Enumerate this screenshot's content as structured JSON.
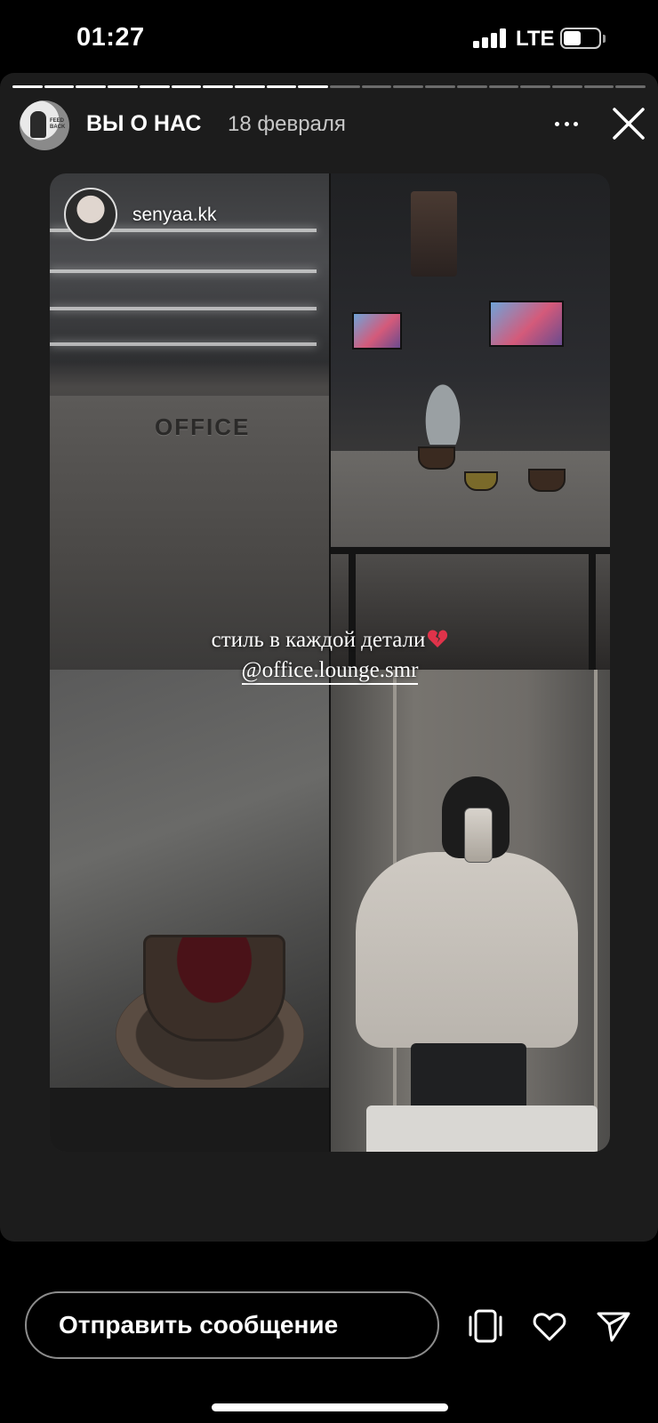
{
  "status_bar": {
    "time": "01:27",
    "network": "LTE",
    "battery_level": 0.5
  },
  "story": {
    "title": "ВЫ О НАС",
    "date": "18 февраля",
    "progress": {
      "segments": 20,
      "viewed": 10
    },
    "avatar_text": "FEED BACK"
  },
  "collage": {
    "mention": "senyaa.kk",
    "bar_sign": "OFFICE",
    "caption": "стиль в каждой детали",
    "caption_link": "@office.lounge.smr"
  },
  "reply": {
    "placeholder": "Отправить сообщение"
  },
  "icons": {
    "signal": "signal-bars-icon",
    "battery": "battery-icon",
    "more": "more-options-icon",
    "close": "close-icon",
    "stickers": "stickers-icon",
    "like": "heart-icon",
    "share": "send-icon",
    "caption_emoji": "broken-heart-icon"
  },
  "colors": {
    "background": "#000000",
    "card": "#1c1c1c",
    "broken_heart": "#e0334a"
  }
}
